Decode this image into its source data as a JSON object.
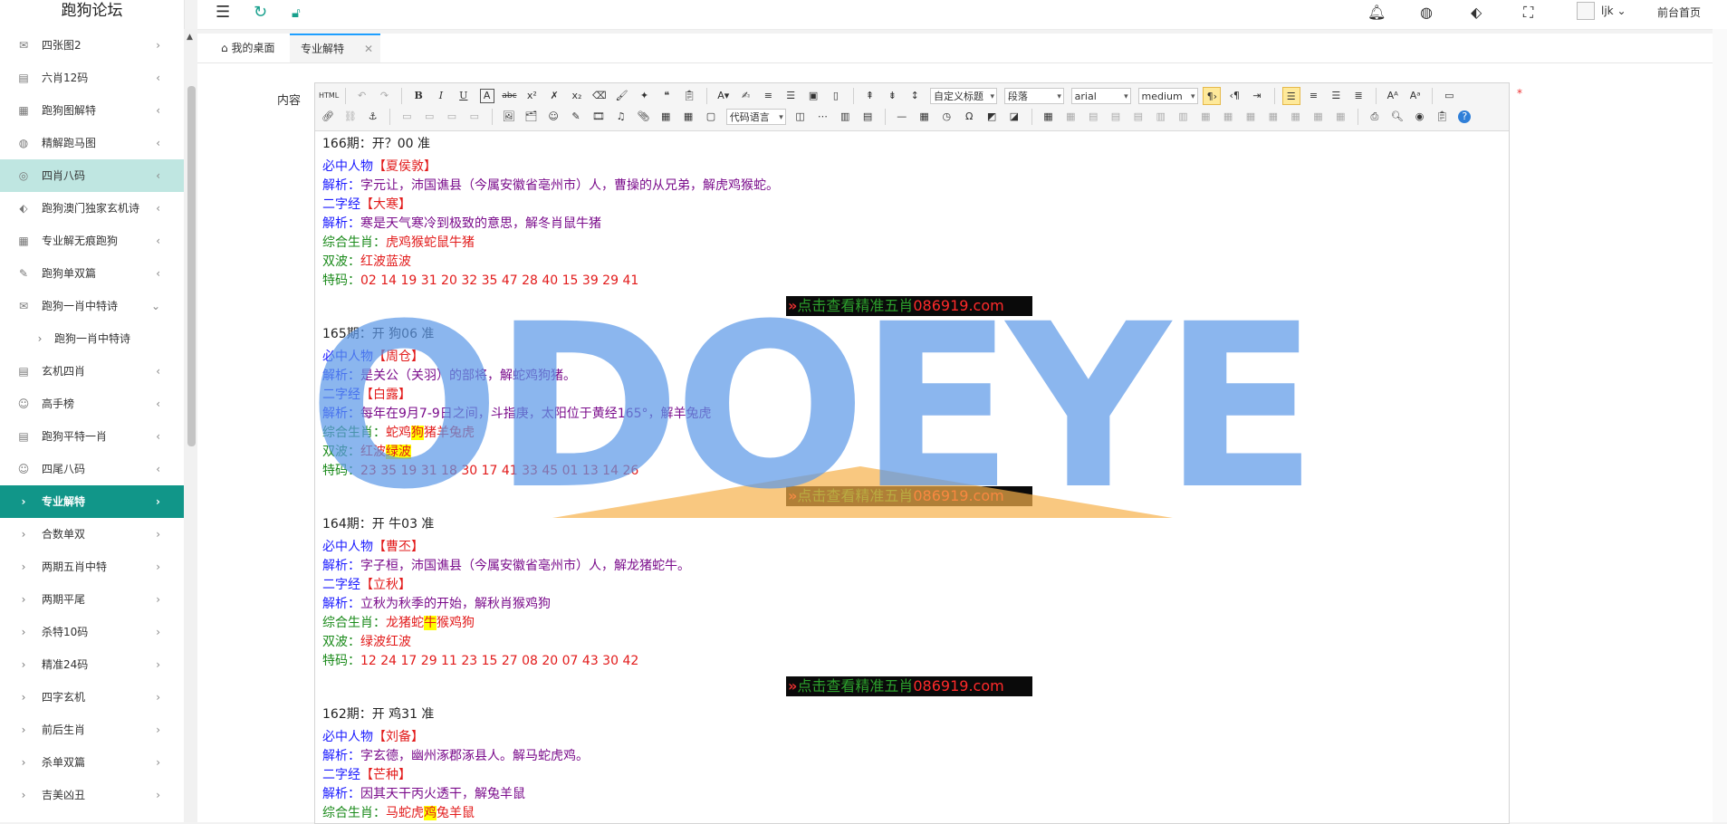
{
  "sidebar": {
    "brand": "跑狗论坛",
    "items": [
      {
        "icon": "envelope-icon",
        "glyph": "✉",
        "label": "四张图2",
        "chevron": "›",
        "state": ""
      },
      {
        "icon": "book-icon",
        "glyph": "▤",
        "label": "六肖12码",
        "chevron": "‹",
        "state": ""
      },
      {
        "icon": "calendar-icon",
        "glyph": "▦",
        "label": "跑狗图解特",
        "chevron": "‹",
        "state": ""
      },
      {
        "icon": "palette-icon",
        "glyph": "◍",
        "label": "精解跑马图",
        "chevron": "‹",
        "state": ""
      },
      {
        "icon": "check-circle-icon",
        "glyph": "◎",
        "label": "四肖八码",
        "chevron": "‹",
        "state": "hl"
      },
      {
        "icon": "tag-icon",
        "glyph": "⬖",
        "label": "跑狗澳门独家玄机诗",
        "chevron": "‹",
        "state": ""
      },
      {
        "icon": "calendar-icon",
        "glyph": "▦",
        "label": "专业解无痕跑狗",
        "chevron": "‹",
        "state": ""
      },
      {
        "icon": "edit-icon",
        "glyph": "✎",
        "label": "跑狗单双篇",
        "chevron": "‹",
        "state": ""
      },
      {
        "icon": "envelope-icon",
        "glyph": "✉",
        "label": "跑狗一肖中特诗",
        "chevron": "⌄",
        "state": ""
      },
      {
        "icon": "chevron-right-icon",
        "glyph": "›",
        "label": "跑狗一肖中特诗",
        "chevron": "",
        "state": "sub"
      },
      {
        "icon": "book-icon",
        "glyph": "▤",
        "label": "玄机四肖",
        "chevron": "‹",
        "state": ""
      },
      {
        "icon": "smile-icon",
        "glyph": "☺",
        "label": "高手榜",
        "chevron": "‹",
        "state": ""
      },
      {
        "icon": "book-icon",
        "glyph": "▤",
        "label": "跑狗平特一肖",
        "chevron": "‹",
        "state": ""
      },
      {
        "icon": "smile-icon",
        "glyph": "☺",
        "label": "四尾八码",
        "chevron": "‹",
        "state": ""
      },
      {
        "icon": "chevron-right-icon",
        "glyph": "›",
        "label": "专业解特",
        "chevron": "›",
        "state": "active"
      },
      {
        "icon": "chevron-right-icon",
        "glyph": "›",
        "label": "合数单双",
        "chevron": "›",
        "state": ""
      },
      {
        "icon": "chevron-right-icon",
        "glyph": "›",
        "label": "两期五肖中特",
        "chevron": "›",
        "state": ""
      },
      {
        "icon": "chevron-right-icon",
        "glyph": "›",
        "label": "两期平尾",
        "chevron": "›",
        "state": ""
      },
      {
        "icon": "chevron-right-icon",
        "glyph": "›",
        "label": "杀特10码",
        "chevron": "›",
        "state": ""
      },
      {
        "icon": "chevron-right-icon",
        "glyph": "›",
        "label": "精准24码",
        "chevron": "›",
        "state": ""
      },
      {
        "icon": "chevron-right-icon",
        "glyph": "›",
        "label": "四字玄机",
        "chevron": "›",
        "state": ""
      },
      {
        "icon": "chevron-right-icon",
        "glyph": "›",
        "label": "前后生肖",
        "chevron": "›",
        "state": ""
      },
      {
        "icon": "chevron-right-icon",
        "glyph": "›",
        "label": "杀单双篇",
        "chevron": "›",
        "state": ""
      },
      {
        "icon": "chevron-right-icon",
        "glyph": "›",
        "label": "吉美凶丑",
        "chevron": "›",
        "state": ""
      }
    ]
  },
  "header": {
    "user": "ljk",
    "front_link": "前台首页"
  },
  "tabs": {
    "home": "我的桌面",
    "active": "专业解特",
    "close": "✕"
  },
  "form": {
    "label": "内容",
    "required": "*"
  },
  "toolbar": {
    "custom_title": "自定义标题",
    "paragraph": "段落",
    "font": "arial",
    "size": "medium",
    "code_lang": "代码语言"
  },
  "ad_banner": {
    "text1": "点击查看精准五肖",
    "text2": "086919.com"
  },
  "periods": [
    {
      "title": "166期：开？00 准",
      "person_label": "必中人物",
      "person": "【夏侯敦】",
      "expl1_label": "解析：",
      "expl1": "字元让，沛国谯县（今属安徽省亳州市）人，曹操的从兄弟，解虎鸡猴蛇。",
      "word_label": "二字经",
      "word": "【大寒】",
      "expl2_label": "解析：",
      "expl2": "寒是天气寒冷到极致的意思，解冬肖鼠牛猪",
      "zodiac_label": "综合生肖：",
      "zodiac": [
        "虎鸡猴蛇鼠牛猪"
      ],
      "wave_label": "双波：",
      "wave": [
        "红波蓝波"
      ],
      "num_label": "特码：",
      "nums": "02 14 19 31 20 32 35 47 28 40 15 39 29 41"
    },
    {
      "title": "165期：开 狗06 准",
      "person_label": "必中人物",
      "person": "【周仓】",
      "expl1_label": "解析：",
      "expl1": "是关公（关羽）的部将，解蛇鸡狗猪。",
      "word_label": "二字经",
      "word": "【白露】",
      "expl2_label": "解析：",
      "expl2": "每年在9月7-9日之间，斗指庚，太阳位于黄经165°，解羊兔虎",
      "zodiac_label": "综合生肖：",
      "zodiac": [
        "蛇鸡",
        "狗",
        "猪羊兔虎"
      ],
      "wave_label": "双波：",
      "wave": [
        "红波",
        "绿波"
      ],
      "num_label": "特码：",
      "nums": "23 35 19 31 18 30 17 41 33 45 01 13 14 26"
    },
    {
      "title": "164期：开 牛03 准",
      "person_label": "必中人物",
      "person": "【曹丕】",
      "expl1_label": "解析：",
      "expl1": "字子桓，沛国谯县（今属安徽省亳州市）人，解龙猪蛇牛。",
      "word_label": "二字经",
      "word": "【立秋】",
      "expl2_label": "解析：",
      "expl2": "立秋为秋季的开始，解秋肖猴鸡狗",
      "zodiac_label": "综合生肖：",
      "zodiac": [
        "龙猪蛇",
        "牛",
        "猴鸡狗"
      ],
      "wave_label": "双波：",
      "wave": [
        "绿波红波"
      ],
      "num_label": "特码：",
      "nums": "12 24 17 29 11 23 15 27 08 20 07 43 30 42"
    },
    {
      "title": "162期：开 鸡31 准",
      "person_label": "必中人物",
      "person": "【刘备】",
      "expl1_label": "解析：",
      "expl1": "字玄德，幽州涿郡涿县人。解马蛇虎鸡。",
      "word_label": "二字经",
      "word": "【芒种】",
      "expl2_label": "解析：",
      "expl2": "因其天干丙火透干，解兔羊鼠",
      "zodiac_label": "综合生肖：",
      "zodiac": [
        "马蛇虎",
        "鸡",
        "兔羊鼠"
      ]
    }
  ],
  "watermark": "ODOEYE"
}
